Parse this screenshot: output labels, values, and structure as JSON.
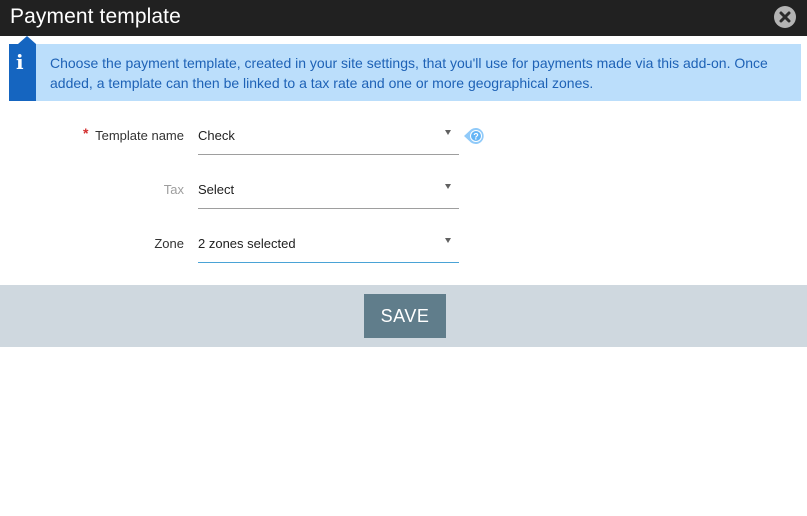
{
  "dialog": {
    "title": "Payment template",
    "close_icon": "close-circle-icon"
  },
  "info": {
    "icon": "info-icon",
    "icon_glyph": "i",
    "text": "Choose the payment template, created in your site settings, that you'll use for payments made via this add-on. Once added, a template can then be linked to a tax rate and one or more geographical zones."
  },
  "form": {
    "required_marker": "*",
    "fields": [
      {
        "label": "Template name",
        "value": "Check",
        "required": true,
        "help_icon": "question-help-icon"
      },
      {
        "label": "Tax",
        "value": "Select",
        "required": false
      },
      {
        "label": "Zone",
        "value": "2 zones selected",
        "required": false
      }
    ]
  },
  "footer": {
    "save_label": "SAVE"
  },
  "colors": {
    "titlebar": "#212121",
    "info_bg": "#bbdefb",
    "info_accent": "#1565c0",
    "info_text": "#1e62b6",
    "footer_bg": "#cfd8df",
    "save_bg": "#607d8b",
    "focus_underline": "#4aa3d6",
    "required": "#d32f2f"
  }
}
